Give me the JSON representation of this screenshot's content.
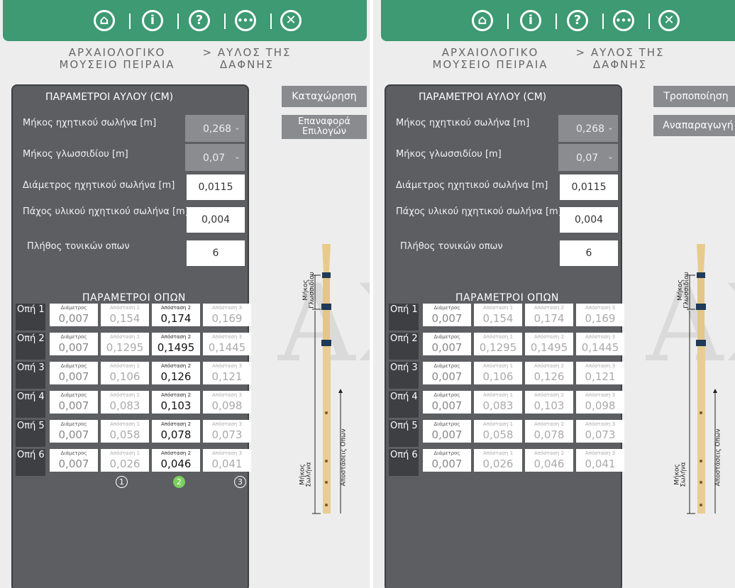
{
  "nav": {
    "icons": [
      "home-icon",
      "info-icon",
      "help-icon",
      "more-icon",
      "close-icon"
    ]
  },
  "panels": [
    {
      "museum_title_1": "ΑΡΧΑΙΟΛΟΓΙΚΟ",
      "museum_title_2": "ΜΟΥΣΕΙΟ ΠΕΙΡΑΙΑ",
      "breadcrumb_1": "> ΑΥΛΟΣ ΤΗΣ",
      "breadcrumb_2": "ΔΑΦΝΗΣ",
      "params_title": "ΠΑΡΑΜΕΤΡΟΙ ΑΥΛΟΥ (CM)",
      "tube_length_label": "Μήκος ηχητικού σωλήνα [m]",
      "tube_length_value": "0,268",
      "reed_length_label": "Μήκος γλωσσιδίου [m]",
      "reed_length_value": "0,07",
      "diameter_label": "Διάμετρος ηχητικού σωλήνα [m]",
      "diameter_value": "0,0115",
      "thickness_label": "Πάχος υλικού ηχητικού σωλήνα [m]",
      "thickness_value": "0,004",
      "holes_count_label": "Πλήθος τονικών οπων",
      "holes_count_value": "6",
      "holes_title": "ΠΑΡΑΜΕΤΡΟΙ ΟΠΩΝ",
      "btn1_label": "Καταχώρηση",
      "btn2_line1": "Επαναφορά",
      "btn2_line2": "Επιλογών",
      "selected_distance": 2,
      "radio_labels": [
        "1",
        "2",
        "3"
      ],
      "holes": [
        {
          "label": "Οπή 1",
          "diameter": "0,007",
          "d1": "0,154",
          "d2": "0,174",
          "d3": "0,169"
        },
        {
          "label": "Οπή 2",
          "diameter": "0,007",
          "d1": "0,1295",
          "d2": "0,1495",
          "d3": "0,1445"
        },
        {
          "label": "Οπή 3",
          "diameter": "0,007",
          "d1": "0,106",
          "d2": "0,126",
          "d3": "0,121"
        },
        {
          "label": "Οπή 4",
          "diameter": "0,007",
          "d1": "0,083",
          "d2": "0,103",
          "d3": "0,098"
        },
        {
          "label": "Οπή 5",
          "diameter": "0,007",
          "d1": "0,058",
          "d2": "0,078",
          "d3": "0,073"
        },
        {
          "label": "Οπή 6",
          "diameter": "0,007",
          "d1": "0,026",
          "d2": "0,046",
          "d3": "0,041"
        }
      ],
      "cap_diameter": "Διάμετρος",
      "cap_d1": "Απόσταση 1",
      "cap_d2": "Απόσταση 2",
      "cap_d3": "Απόσταση 3",
      "flute_reed_label_1": "Μήκος",
      "flute_reed_label_2": "Γλωσσιδίου",
      "flute_tube_label_1": "Μήκος",
      "flute_tube_label_2": "Σωλήνα",
      "flute_holes_label": "Αποστάσεις Οπών",
      "watermark": "ΑΣ"
    },
    {
      "museum_title_1": "ΑΡΧΑΙΟΛΟΓΙΚΟ",
      "museum_title_2": "ΜΟΥΣΕΙΟ ΠΕΙΡΑΙΑ",
      "breadcrumb_1": "> ΑΥΛΟΣ ΤΗΣ",
      "breadcrumb_2": "ΔΑΦΝΗΣ",
      "params_title": "ΠΑΡΑΜΕΤΡΟΙ ΑΥΛΟΥ (CM)",
      "tube_length_label": "Μήκος ηχητικού σωλήνα [m]",
      "tube_length_value": "0,268",
      "reed_length_label": "Μήκος γλωσσιδίου [m]",
      "reed_length_value": "0,07",
      "diameter_label": "Διάμετρος ηχητικού σωλήνα [m]",
      "diameter_value": "0,0115",
      "thickness_label": "Πάχος υλικού ηχητικού σωλήνα [m]",
      "thickness_value": "0,004",
      "holes_count_label": "Πλήθος τονικών οπων",
      "holes_count_value": "6",
      "holes_title": "ΠΑΡΑΜΕΤΡΟΙ ΟΠΩΝ",
      "btn1_label": "Τροποποίηση",
      "btn2_label": "Αναπαραγωγή",
      "selected_distance": 0,
      "holes": [
        {
          "label": "Οπή 1",
          "diameter": "0,007",
          "d1": "0,154",
          "d2": "0,174",
          "d3": "0,169"
        },
        {
          "label": "Οπή 2",
          "diameter": "0,007",
          "d1": "0,1295",
          "d2": "0,1495",
          "d3": "0,1445"
        },
        {
          "label": "Οπή 3",
          "diameter": "0,007",
          "d1": "0,106",
          "d2": "0,126",
          "d3": "0,121"
        },
        {
          "label": "Οπή 4",
          "diameter": "0,007",
          "d1": "0,083",
          "d2": "0,103",
          "d3": "0,098"
        },
        {
          "label": "Οπή 5",
          "diameter": "0,007",
          "d1": "0,058",
          "d2": "0,078",
          "d3": "0,073"
        },
        {
          "label": "Οπή 6",
          "diameter": "0,007",
          "d1": "0,026",
          "d2": "0,046",
          "d3": "0,041"
        }
      ],
      "cap_diameter": "Διάμετρος",
      "cap_d1": "Απόσταση 1",
      "cap_d2": "Απόσταση 2",
      "cap_d3": "Απόσταση 3",
      "flute_reed_label_1": "Μήκος",
      "flute_reed_label_2": "Γλωσσιδίου",
      "flute_tube_label_1": "Μήκος",
      "flute_tube_label_2": "Σωλήνα",
      "flute_holes_label": "Αποστάσεις Οπών",
      "watermark": "ΑΣ"
    }
  ]
}
